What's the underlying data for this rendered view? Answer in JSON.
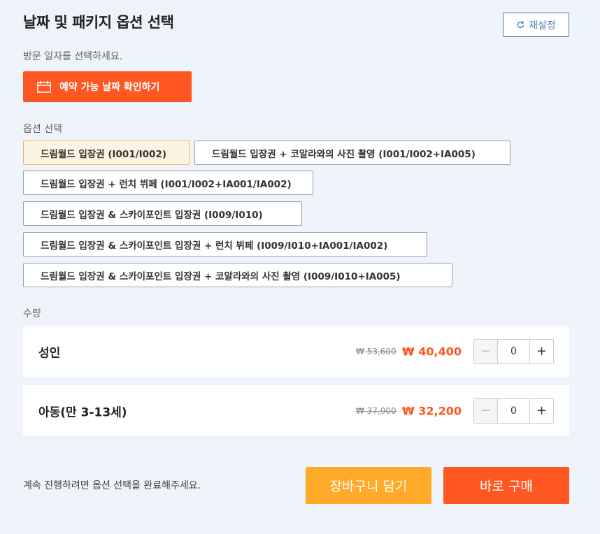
{
  "header": {
    "title": "날짜 및 패키지 옵션 선택",
    "reset_label": "재설정"
  },
  "date_section": {
    "label": "방문 일자를 선택하세요.",
    "button_label": "예약 가능 날짜 확인하기"
  },
  "options_section": {
    "label": "옵션 선택",
    "options": [
      {
        "label": "드림월드 입장권 (I001/I002)",
        "selected": true
      },
      {
        "label": "드림월드 입장권 + 코알라와의 사진 촬영 (I001/I002+IA005)",
        "selected": false
      },
      {
        "label": "드림월드 입장권 + 런치 뷔페 (I001/I002+IA001/IA002)",
        "selected": false
      },
      {
        "label": "드림월드 입장권 & 스카이포인트 입장권 (I009/I010)",
        "selected": false
      },
      {
        "label": "드림월드 입장권 & 스카이포인트 입장권 + 런치 뷔페 (I009/I010+IA001/IA002)",
        "selected": false
      },
      {
        "label": "드림월드 입장권 & 스카이포인트 입장권 + 코알라와의 사진 촬영 (I009/I010+IA005)",
        "selected": false
      }
    ]
  },
  "quantity_section": {
    "label": "수량",
    "items": [
      {
        "name": "성인",
        "old_price": "₩ 53,600",
        "new_price": "₩ 40,400",
        "minus": "−",
        "quantity": "0",
        "plus": "+"
      },
      {
        "name": "아동(만 3-13세)",
        "old_price": "₩ 37,900",
        "new_price": "₩ 32,200",
        "minus": "−",
        "quantity": "0",
        "plus": "+"
      }
    ]
  },
  "footer": {
    "message": "계속 진행하려면 옵션 선택을 완료해주세요.",
    "cart_label": "장바구니 담기",
    "buy_label": "바로 구매"
  },
  "colors": {
    "accent": "#ff5722",
    "cart": "#ffaa28",
    "link": "#4a78b5",
    "background": "#eef4fa"
  }
}
